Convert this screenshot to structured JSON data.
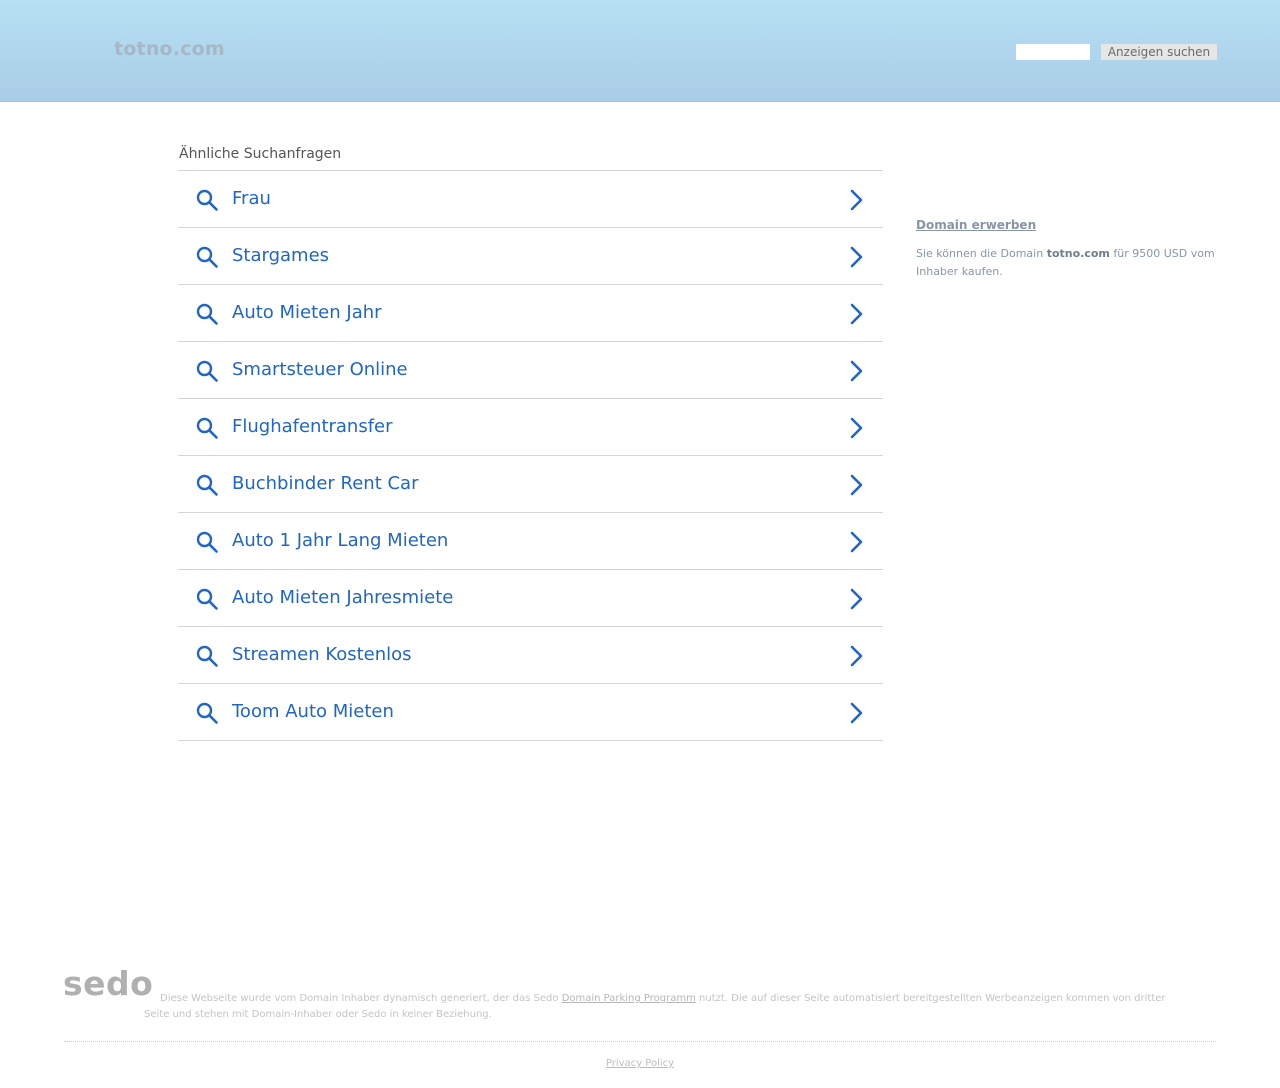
{
  "header": {
    "logo": "totno.com",
    "search_value": "",
    "search_button": "Anzeigen suchen"
  },
  "related": {
    "title": "Ähnliche Suchanfragen",
    "items": [
      {
        "label": "Frau"
      },
      {
        "label": "Stargames"
      },
      {
        "label": "Auto Mieten Jahr"
      },
      {
        "label": "Smartsteuer Online"
      },
      {
        "label": "Flughafentransfer"
      },
      {
        "label": "Buchbinder Rent Car"
      },
      {
        "label": "Auto 1 Jahr Lang Mieten"
      },
      {
        "label": "Auto Mieten Jahresmiete"
      },
      {
        "label": "Streamen Kostenlos"
      },
      {
        "label": "Toom Auto Mieten"
      }
    ],
    "icon": "search-icon",
    "arrow_icon": "chevron-right-icon"
  },
  "aside": {
    "title": "Domain erwerben",
    "text_before": "Sie können die Domain ",
    "domain": "totno.com",
    "text_after": " für 9500 USD vom Inhaber kaufen."
  },
  "footer": {
    "sedo_logo": "sedo",
    "disclaimer_before": "Diese Webseite wurde vom Domain Inhaber dynamisch generiert, der das Sedo ",
    "disclaimer_link": "Domain Parking Programm",
    "disclaimer_after": " nutzt. Die auf dieser Seite automatisiert bereitgestellten Werbeanzeigen kommen von dritter Seite und stehen mit Domain-Inhaber oder Sedo in keiner Beziehung.",
    "privacy_link": "Privacy Policy"
  },
  "colors": {
    "link_blue": "#2166c3",
    "header_top": "#b6e0f4",
    "header_bottom": "#a9cde6",
    "muted_text": "#8796a6"
  }
}
